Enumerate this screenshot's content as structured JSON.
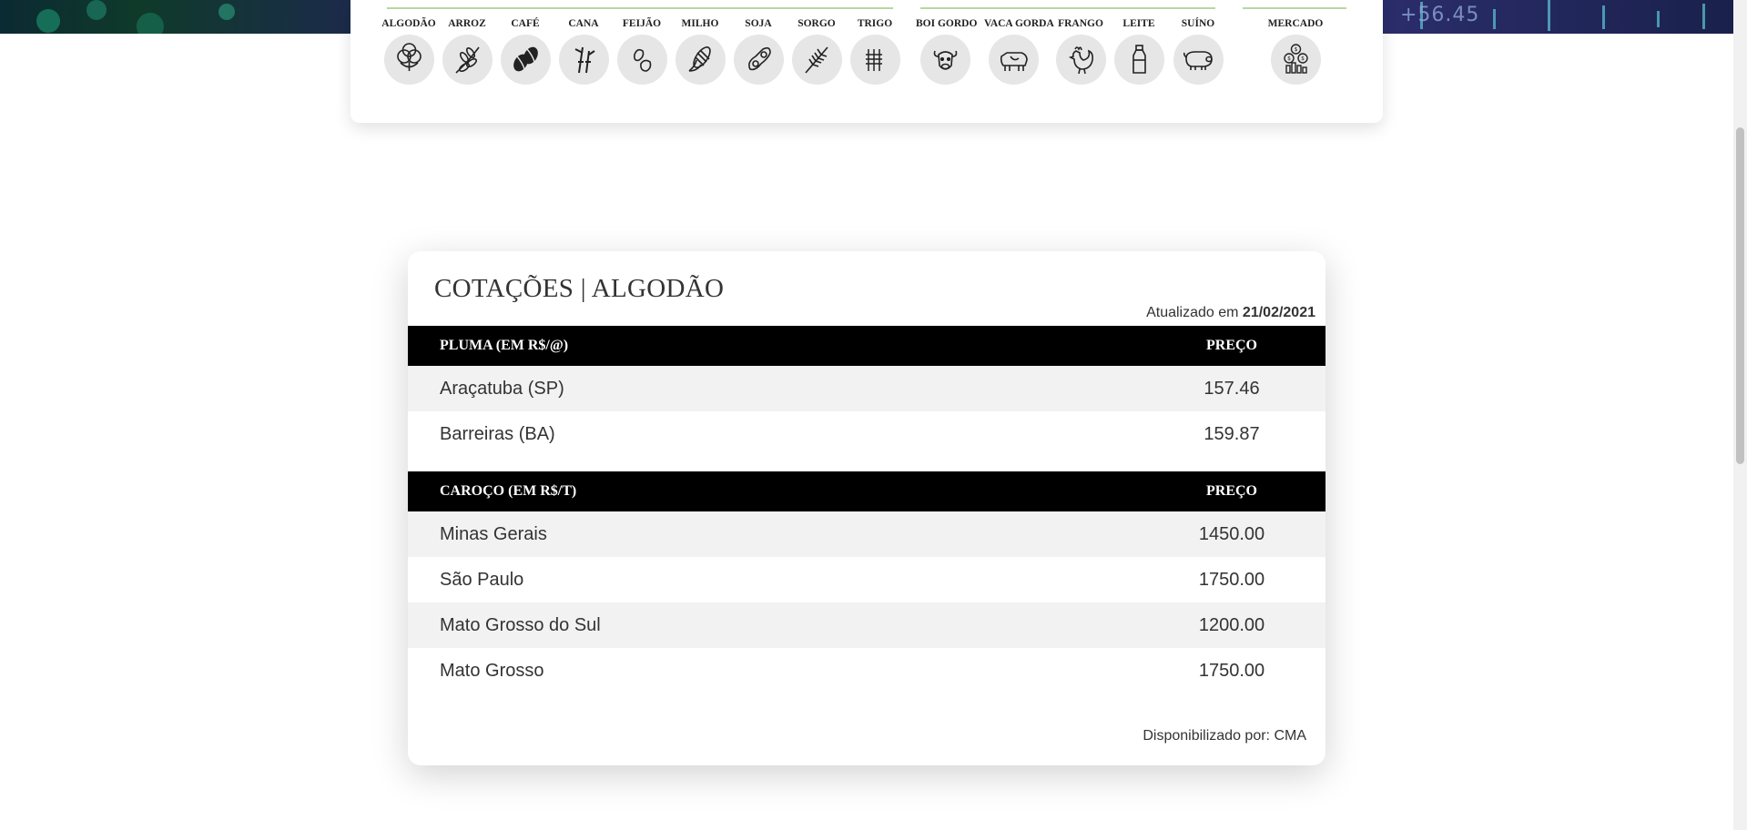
{
  "banner": {
    "ticker_text": "+56.45"
  },
  "categories": {
    "agricultura": [
      {
        "label": "ALGODÃO",
        "icon": "cotton-icon"
      },
      {
        "label": "ARROZ",
        "icon": "rice-icon"
      },
      {
        "label": "CAFÉ",
        "icon": "coffee-bean-icon"
      },
      {
        "label": "CANA",
        "icon": "sugarcane-icon"
      },
      {
        "label": "FEIJÃO",
        "icon": "bean-icon"
      },
      {
        "label": "MILHO",
        "icon": "corn-icon"
      },
      {
        "label": "SOJA",
        "icon": "soy-icon"
      },
      {
        "label": "SORGO",
        "icon": "sorghum-icon"
      },
      {
        "label": "TRIGO",
        "icon": "wheat-icon"
      }
    ],
    "pecuaria": [
      {
        "label": "BOI GORDO",
        "icon": "bull-icon"
      },
      {
        "label": "VACA GORDA",
        "icon": "cow-icon"
      },
      {
        "label": "FRANGO",
        "icon": "rooster-icon"
      },
      {
        "label": "LEITE",
        "icon": "milk-bottle-icon"
      },
      {
        "label": "SUÍNO",
        "icon": "pig-icon"
      }
    ],
    "mercado": [
      {
        "label": "MERCADO",
        "icon": "market-coins-icon"
      }
    ]
  },
  "quotes": {
    "title": "COTAÇÕES | ALGODÃO",
    "updated_prefix": "Atualizado em",
    "updated_date": "21/02/2021",
    "sections": [
      {
        "header": "PLUMA (EM R$/@)",
        "price_header": "PREÇO",
        "rows": [
          {
            "name": "Araçatuba (SP)",
            "price": "157.46"
          },
          {
            "name": "Barreiras (BA)",
            "price": "159.87"
          }
        ]
      },
      {
        "header": "CAROÇO (EM R$/T)",
        "price_header": "PREÇO",
        "rows": [
          {
            "name": "Minas Gerais",
            "price": "1450.00"
          },
          {
            "name": "São Paulo",
            "price": "1750.00"
          },
          {
            "name": "Mato Grosso do Sul",
            "price": "1200.00"
          },
          {
            "name": "Mato Grosso",
            "price": "1750.00"
          }
        ]
      }
    ],
    "source": "Disponibilizado por: CMA"
  }
}
